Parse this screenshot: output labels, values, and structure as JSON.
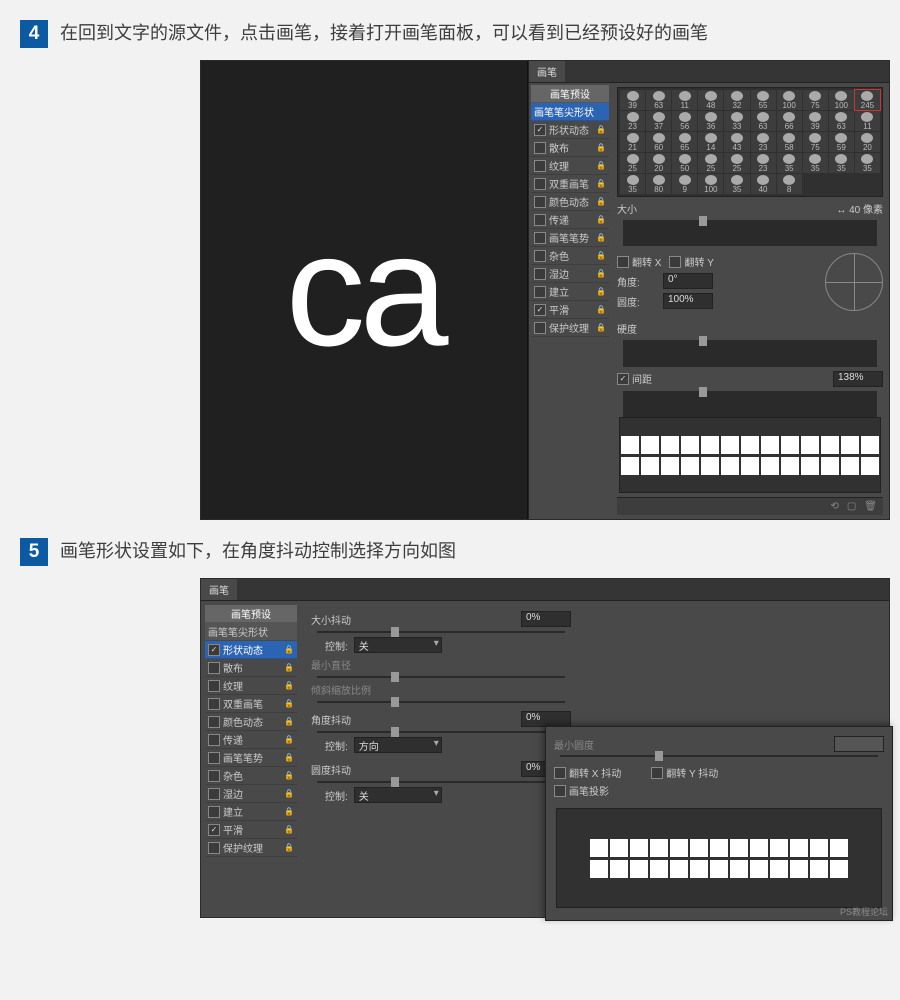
{
  "step4": {
    "num": "4",
    "text": "在回到文字的源文件，点击画笔，接着打开画笔面板，可以看到已经预设好的画笔",
    "canvas_text": "ca",
    "panel_tab": "画笔",
    "side": {
      "preset": "画笔预设",
      "tip": "画笔笔尖形状",
      "items": [
        {
          "label": "形状动态",
          "checked": true
        },
        {
          "label": "散布",
          "checked": false
        },
        {
          "label": "纹理",
          "checked": false
        },
        {
          "label": "双重画笔",
          "checked": false
        },
        {
          "label": "颜色动态",
          "checked": false
        },
        {
          "label": "传递",
          "checked": false
        },
        {
          "label": "画笔笔势",
          "checked": false
        },
        {
          "label": "杂色",
          "checked": false
        },
        {
          "label": "湿边",
          "checked": false
        },
        {
          "label": "建立",
          "checked": false
        },
        {
          "label": "平滑",
          "checked": true
        },
        {
          "label": "保护纹理",
          "checked": false
        }
      ]
    },
    "brush_sizes": [
      [
        39,
        63,
        11,
        48,
        32,
        55,
        100,
        75,
        100,
        245,
        23
      ],
      [
        37,
        56,
        36,
        33,
        63,
        66,
        39,
        63,
        11,
        21,
        60,
        65
      ],
      [
        14,
        43,
        23,
        58,
        75,
        59,
        20,
        25,
        20,
        50,
        25,
        25
      ],
      [
        23,
        35,
        35,
        35,
        35,
        35,
        80,
        9,
        100,
        35,
        40,
        8
      ]
    ],
    "size_lbl": "大小",
    "size_val": "40",
    "size_unit": "像素",
    "flipx": "翻转 X",
    "flipy": "翻转 Y",
    "angle_lbl": "角度:",
    "angle_val": "0°",
    "round_lbl": "圆度:",
    "round_val": "100%",
    "hard_lbl": "硬度",
    "spacing_lbl": "间距",
    "spacing_val": "138%"
  },
  "step5": {
    "num": "5",
    "text": "画笔形状设置如下，在角度抖动控制选择方向如图",
    "panel_tab": "画笔",
    "side": {
      "preset": "画笔预设",
      "tip": "画笔笔尖形状",
      "items": [
        {
          "label": "形状动态",
          "checked": true
        },
        {
          "label": "散布",
          "checked": false
        },
        {
          "label": "纹理",
          "checked": false
        },
        {
          "label": "双重画笔",
          "checked": false
        },
        {
          "label": "颜色动态",
          "checked": false
        },
        {
          "label": "传递",
          "checked": false
        },
        {
          "label": "画笔笔势",
          "checked": false
        },
        {
          "label": "杂色",
          "checked": false
        },
        {
          "label": "湿边",
          "checked": false
        },
        {
          "label": "建立",
          "checked": false
        },
        {
          "label": "平滑",
          "checked": true
        },
        {
          "label": "保护纹理",
          "checked": false
        }
      ]
    },
    "size_jitter_lbl": "大小抖动",
    "size_jitter_val": "0%",
    "control_lbl": "控制:",
    "control_off": "关",
    "control_dir": "方向",
    "min_diam": "最小直径",
    "tilt_scale": "倾斜缩放比例",
    "angle_jitter_lbl": "角度抖动",
    "angle_jitter_val": "0%",
    "round_jitter_lbl": "圆度抖动",
    "round_jitter_val": "0%",
    "min_round": "最小圆度",
    "flipx_jit": "翻转 X 抖动",
    "flipy_jit": "翻转 Y 抖动",
    "brush_proj": "画笔投影",
    "watermark": "PS教程论坛"
  }
}
